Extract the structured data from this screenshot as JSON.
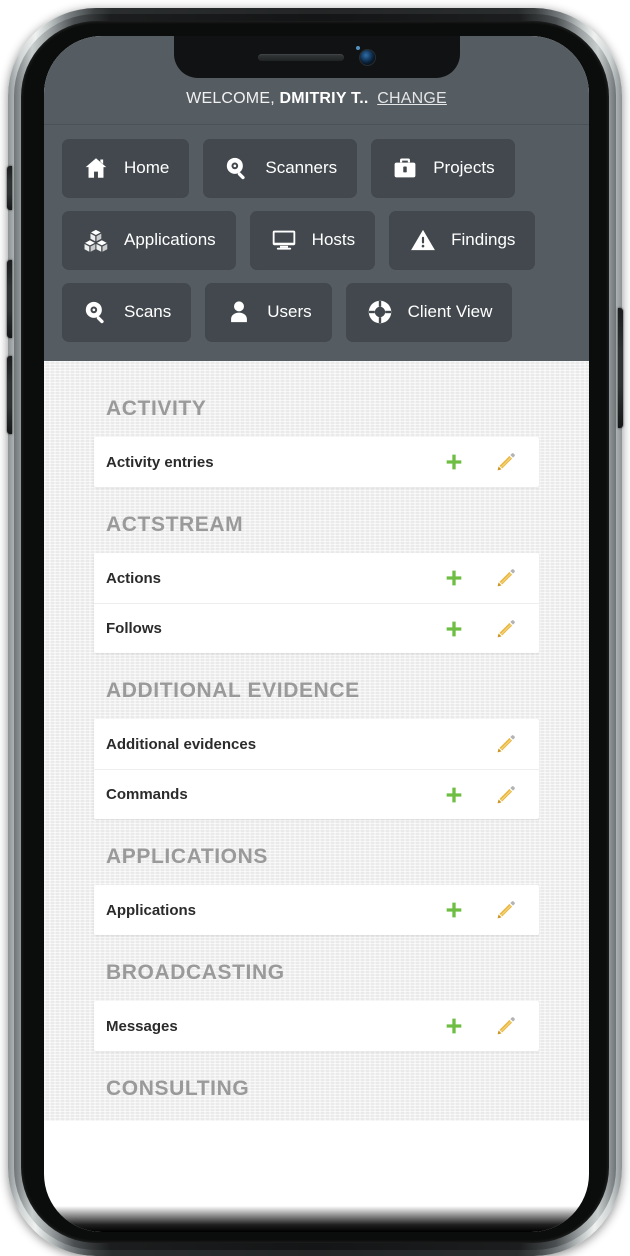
{
  "device": {
    "type": "smartphone-mockup",
    "notch": {
      "speaker": "speaker-grille",
      "camera": "front-camera"
    },
    "buttons": [
      "silent-switch",
      "volume-up",
      "volume-down",
      "power"
    ]
  },
  "header": {
    "welcome_prefix": "WELCOME,",
    "user_name": "DMITRIY T..",
    "change_label": "CHANGE"
  },
  "nav": {
    "items": [
      {
        "label": "Home",
        "icon": "home-icon"
      },
      {
        "label": "Scanners",
        "icon": "magnifier-icon"
      },
      {
        "label": "Projects",
        "icon": "briefcase-icon"
      },
      {
        "label": "Applications",
        "icon": "boxes-icon"
      },
      {
        "label": "Hosts",
        "icon": "monitor-icon"
      },
      {
        "label": "Findings",
        "icon": "warning-triangle-icon"
      },
      {
        "label": "Scans",
        "icon": "magnifier-icon"
      },
      {
        "label": "Users",
        "icon": "user-icon"
      },
      {
        "label": "Client View",
        "icon": "lifering-icon"
      }
    ]
  },
  "actions": {
    "add_label": "+",
    "change_label": "pencil-icon"
  },
  "colors": {
    "header_bg": "#555c62",
    "nav_button_bg": "#42484d",
    "content_bg": "#efefef",
    "card_bg": "#ffffff",
    "group_title": "#9a9a9a",
    "model_name": "#2b2b2b",
    "add_green": "#6fbe44",
    "edit_yellow": "#e8b740"
  },
  "groups": [
    {
      "title": "ACTIVITY",
      "models": [
        {
          "name": "Activity entries",
          "can_add": true,
          "can_change": true
        }
      ]
    },
    {
      "title": "ACTSTREAM",
      "models": [
        {
          "name": "Actions",
          "can_add": true,
          "can_change": true
        },
        {
          "name": "Follows",
          "can_add": true,
          "can_change": true
        }
      ]
    },
    {
      "title": "ADDITIONAL EVIDENCE",
      "models": [
        {
          "name": "Additional evidences",
          "can_add": false,
          "can_change": true
        },
        {
          "name": "Commands",
          "can_add": true,
          "can_change": true
        }
      ]
    },
    {
      "title": "APPLICATIONS",
      "models": [
        {
          "name": "Applications",
          "can_add": true,
          "can_change": true
        }
      ]
    },
    {
      "title": "BROADCASTING",
      "models": [
        {
          "name": "Messages",
          "can_add": true,
          "can_change": true
        }
      ]
    },
    {
      "title": "CONSULTING",
      "models": []
    }
  ]
}
